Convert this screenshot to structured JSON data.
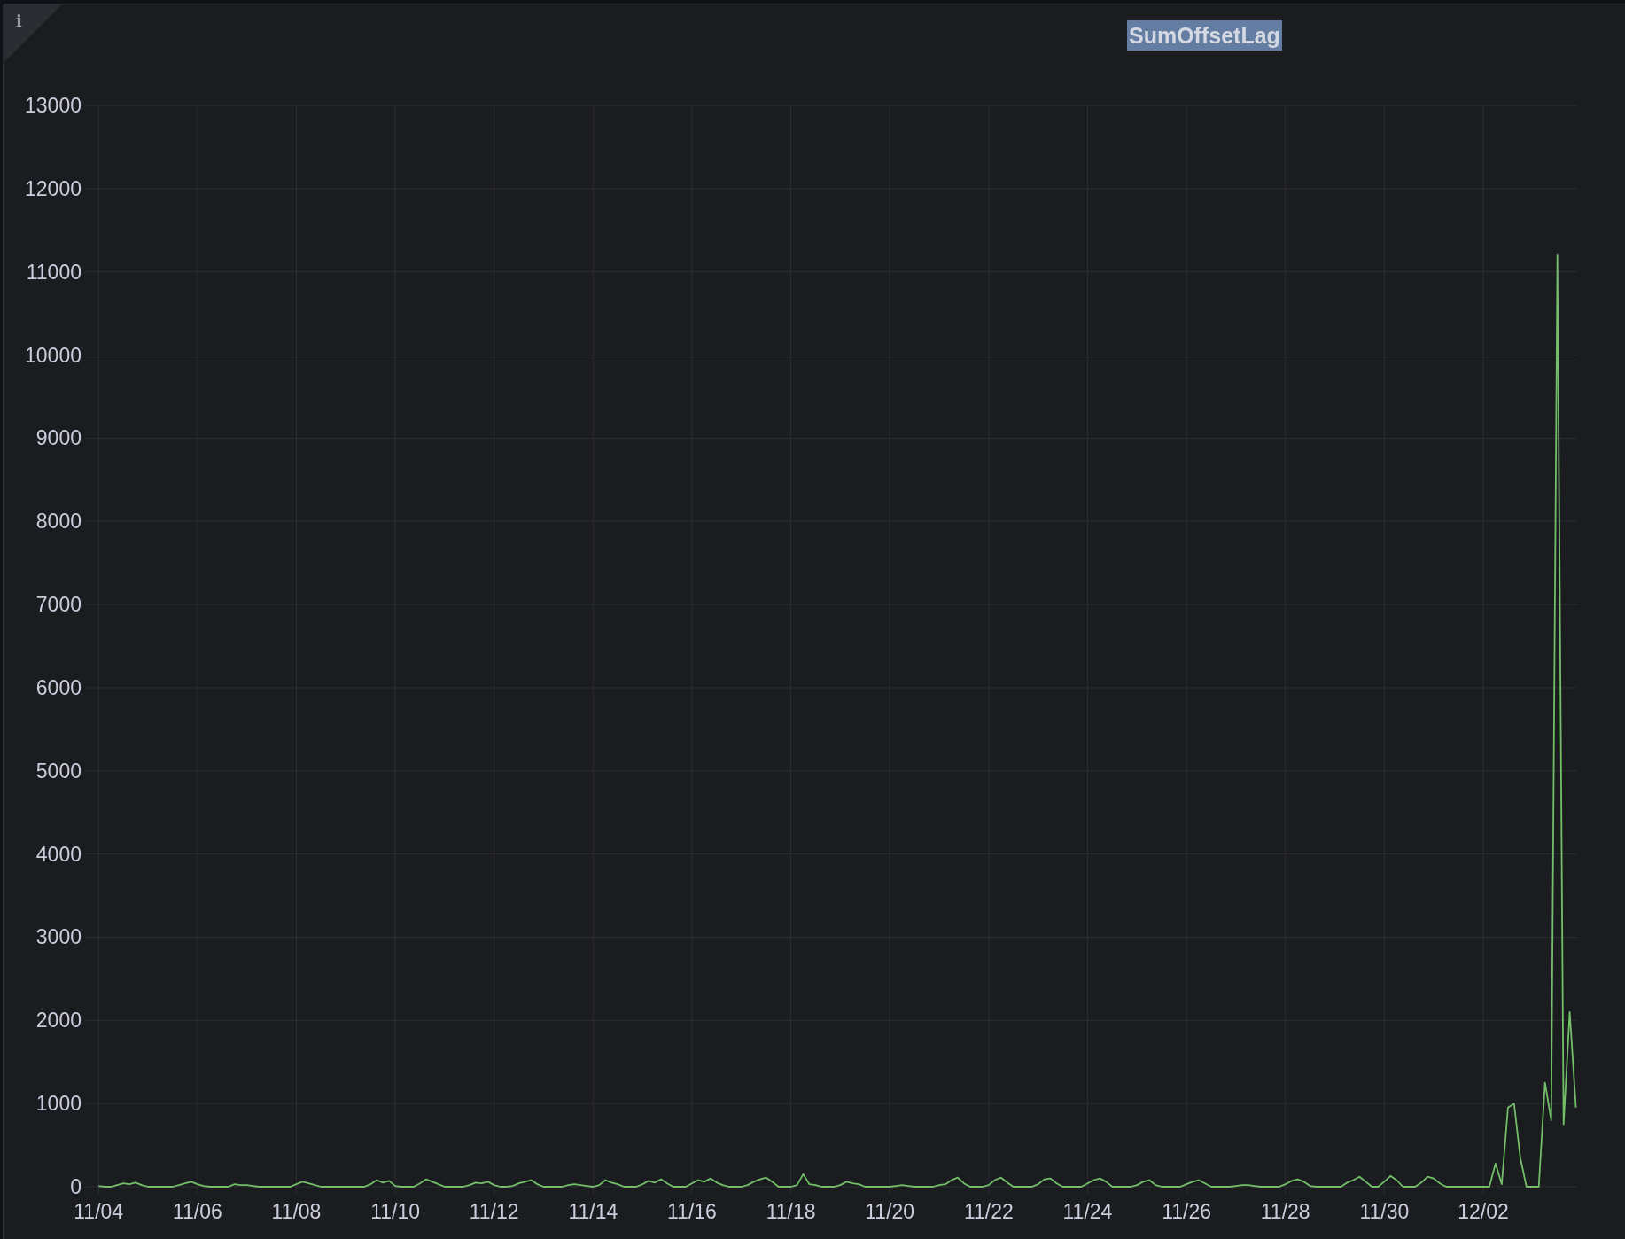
{
  "panel": {
    "title": "SumOffsetLag",
    "info_icon": "i",
    "chart_data": {
      "type": "line",
      "grid": true,
      "ylim": [
        0,
        13000
      ],
      "yticks": [
        0,
        1000,
        2000,
        3000,
        4000,
        5000,
        6000,
        7000,
        8000,
        9000,
        10000,
        11000,
        12000,
        13000
      ],
      "categories": [
        "11/04",
        null,
        null,
        null,
        null,
        null,
        null,
        null,
        null,
        null,
        null,
        null,
        null,
        null,
        null,
        null,
        "11/06",
        null,
        null,
        null,
        null,
        null,
        null,
        null,
        null,
        null,
        null,
        null,
        null,
        null,
        null,
        null,
        "11/08",
        null,
        null,
        null,
        null,
        null,
        null,
        null,
        null,
        null,
        null,
        null,
        null,
        null,
        null,
        null,
        "11/10",
        null,
        null,
        null,
        null,
        null,
        null,
        null,
        null,
        null,
        null,
        null,
        null,
        null,
        null,
        null,
        "11/12",
        null,
        null,
        null,
        null,
        null,
        null,
        null,
        null,
        null,
        null,
        null,
        null,
        null,
        null,
        null,
        "11/14",
        null,
        null,
        null,
        null,
        null,
        null,
        null,
        null,
        null,
        null,
        null,
        null,
        null,
        null,
        null,
        "11/16",
        null,
        null,
        null,
        null,
        null,
        null,
        null,
        null,
        null,
        null,
        null,
        null,
        null,
        null,
        null,
        "11/18",
        null,
        null,
        null,
        null,
        null,
        null,
        null,
        null,
        null,
        null,
        null,
        null,
        null,
        null,
        null,
        "11/20",
        null,
        null,
        null,
        null,
        null,
        null,
        null,
        null,
        null,
        null,
        null,
        null,
        null,
        null,
        null,
        "11/22",
        null,
        null,
        null,
        null,
        null,
        null,
        null,
        null,
        null,
        null,
        null,
        null,
        null,
        null,
        null,
        "11/24",
        null,
        null,
        null,
        null,
        null,
        null,
        null,
        null,
        null,
        null,
        null,
        null,
        null,
        null,
        null,
        "11/26",
        null,
        null,
        null,
        null,
        null,
        null,
        null,
        null,
        null,
        null,
        null,
        null,
        null,
        null,
        null,
        "11/28",
        null,
        null,
        null,
        null,
        null,
        null,
        null,
        null,
        null,
        null,
        null,
        null,
        null,
        null,
        null,
        "11/30",
        null,
        null,
        null,
        null,
        null,
        null,
        null,
        null,
        null,
        null,
        null,
        null,
        null,
        null,
        null,
        "12/02",
        null,
        null,
        null,
        null,
        null,
        null,
        null,
        null,
        null,
        null,
        null,
        null,
        null,
        null,
        null
      ],
      "series": [
        {
          "color": "#73bf69",
          "values": [
            10,
            0,
            0,
            20,
            40,
            30,
            50,
            20,
            0,
            0,
            0,
            0,
            0,
            20,
            40,
            60,
            30,
            10,
            0,
            0,
            0,
            0,
            30,
            20,
            20,
            10,
            0,
            0,
            0,
            0,
            0,
            0,
            30,
            60,
            40,
            20,
            0,
            0,
            0,
            0,
            0,
            0,
            0,
            0,
            30,
            80,
            50,
            70,
            10,
            0,
            0,
            0,
            40,
            90,
            60,
            30,
            0,
            0,
            0,
            0,
            20,
            50,
            40,
            60,
            20,
            0,
            0,
            10,
            40,
            60,
            80,
            30,
            0,
            0,
            0,
            0,
            20,
            30,
            20,
            10,
            0,
            20,
            80,
            50,
            30,
            0,
            0,
            0,
            30,
            70,
            50,
            90,
            40,
            0,
            0,
            0,
            40,
            80,
            60,
            100,
            50,
            20,
            0,
            0,
            0,
            20,
            60,
            90,
            110,
            60,
            0,
            0,
            0,
            20,
            150,
            30,
            20,
            0,
            0,
            0,
            20,
            60,
            40,
            30,
            0,
            0,
            0,
            0,
            0,
            10,
            20,
            10,
            0,
            0,
            0,
            0,
            20,
            30,
            80,
            110,
            40,
            0,
            0,
            0,
            20,
            80,
            110,
            50,
            0,
            0,
            0,
            0,
            30,
            90,
            100,
            40,
            0,
            0,
            0,
            0,
            40,
            80,
            100,
            60,
            0,
            0,
            0,
            0,
            20,
            60,
            80,
            20,
            0,
            0,
            0,
            0,
            30,
            60,
            80,
            40,
            0,
            0,
            0,
            0,
            10,
            20,
            20,
            10,
            0,
            0,
            0,
            0,
            30,
            70,
            90,
            60,
            10,
            0,
            0,
            0,
            0,
            0,
            50,
            80,
            120,
            60,
            0,
            0,
            60,
            130,
            80,
            0,
            0,
            0,
            50,
            120,
            100,
            40,
            0,
            0,
            0,
            0,
            0,
            0,
            0,
            0,
            280,
            30,
            950,
            1000,
            350,
            0,
            0,
            0,
            1250,
            800,
            11200,
            750,
            2100,
            950
          ]
        }
      ]
    }
  }
}
